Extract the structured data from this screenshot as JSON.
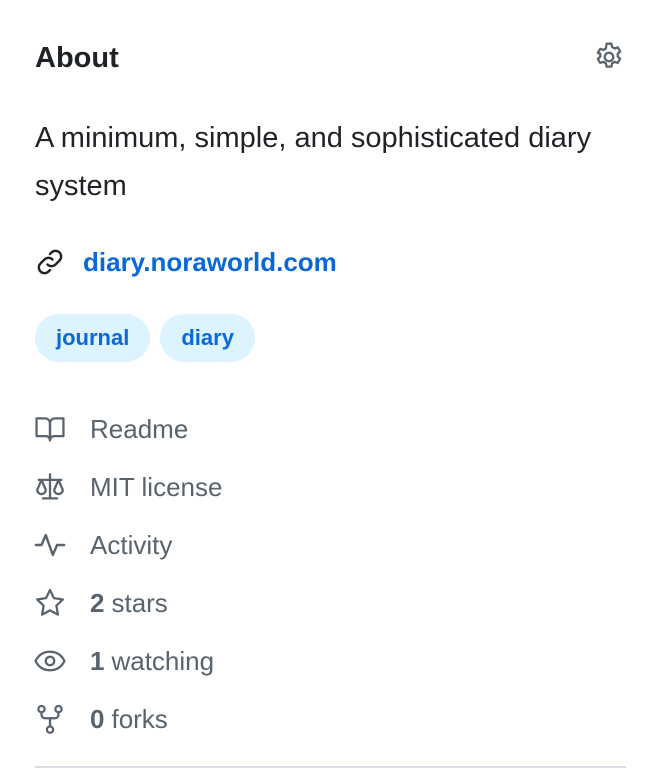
{
  "about": {
    "title": "About",
    "description": "A minimum, simple, and sophisticated diary system",
    "website": "diary.noraworld.com",
    "topics": [
      "journal",
      "diary"
    ]
  },
  "stats": {
    "readme": "Readme",
    "license": "MIT license",
    "activity": "Activity",
    "stars_count": "2",
    "stars_label": "stars",
    "watching_count": "1",
    "watching_label": "watching",
    "forks_count": "0",
    "forks_label": "forks"
  },
  "icons": {
    "settings": "gear-icon",
    "link": "link-icon",
    "readme": "book-icon",
    "license": "law-icon",
    "activity": "pulse-icon",
    "stars": "star-icon",
    "watching": "eye-icon",
    "forks": "repo-forked-icon"
  },
  "colors": {
    "link": "#0969da",
    "topic_bg": "#ddf4ff",
    "muted": "#59636e",
    "text": "#1f2328"
  }
}
